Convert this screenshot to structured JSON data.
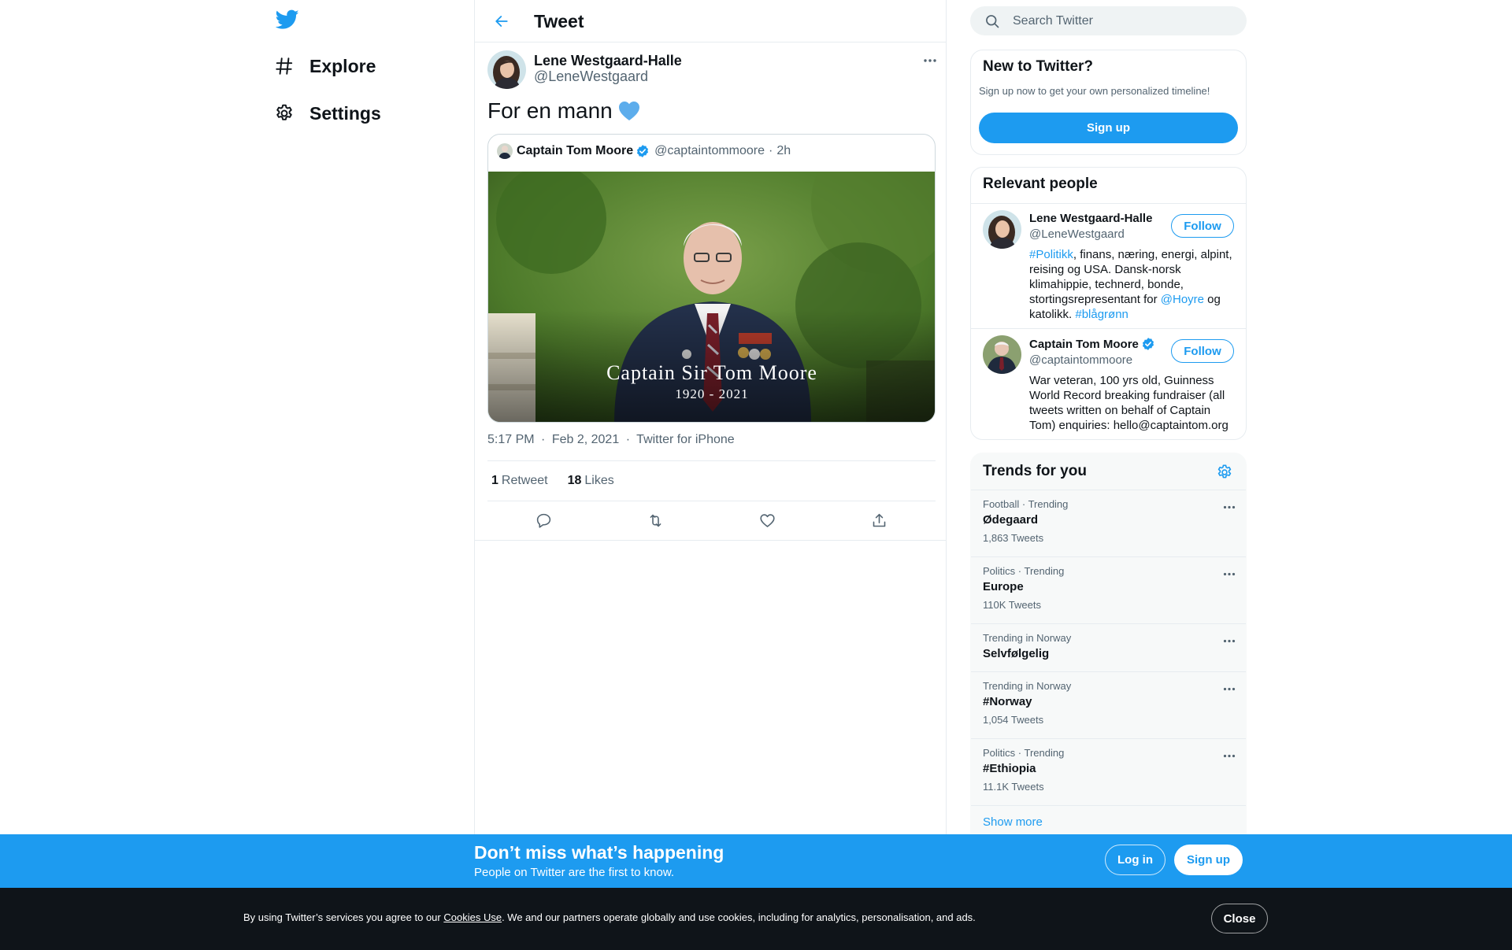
{
  "nav": {
    "items": [
      {
        "label": "Explore",
        "icon": "hashtag-icon"
      },
      {
        "label": "Settings",
        "icon": "gear-icon"
      }
    ]
  },
  "header": {
    "title": "Tweet"
  },
  "tweet": {
    "author_name": "Lene Westgaard-Halle",
    "author_handle": "@LeneWestgaard",
    "text": "For en mann",
    "emoji": "blue-heart",
    "quote": {
      "author_name": "Captain Tom Moore",
      "author_handle": "@captaintommoore",
      "separator": "·",
      "time": "2h",
      "image_title": "Captain Sir Tom Moore",
      "image_years": "1920 - 2021"
    },
    "time": "5:17 PM",
    "dot": "·",
    "date": "Feb 2, 2021",
    "source": "Twitter for iPhone",
    "retweets": "1",
    "retweets_label": "Retweet",
    "likes": "18",
    "likes_label": "Likes"
  },
  "search": {
    "placeholder": "Search Twitter"
  },
  "new_to_twitter": {
    "title": "New to Twitter?",
    "subtitle": "Sign up now to get your own personalized timeline!",
    "button": "Sign up"
  },
  "relevant_people": {
    "title": "Relevant people",
    "follow_label": "Follow",
    "people": [
      {
        "name": "Lene Westgaard-Halle",
        "handle": "@LeneWestgaard",
        "bio_parts": {
          "tag1": "#Politikk",
          "text1": ", finans, næring, energi, alpint, reising og USA. Dansk-norsk klimahippie, technerd, bonde, stortingsrepresentant for ",
          "mention": "@Hoyre",
          "text2": " og katolikk. ",
          "tag2": "#blågrønn"
        }
      },
      {
        "name": "Captain Tom Moore",
        "handle": "@captaintommoore",
        "bio": "War veteran, 100 yrs old, Guinness World Record breaking fundraiser (all tweets written on behalf of Captain Tom) enquiries: hello@captaintom.org"
      }
    ]
  },
  "trends": {
    "title": "Trends for you",
    "items": [
      {
        "context": "Football · Trending",
        "name": "Ødegaard",
        "count": "1,863 Tweets"
      },
      {
        "context": "Politics · Trending",
        "name": "Europe",
        "count": "110K Tweets"
      },
      {
        "context": "Trending in Norway",
        "name": "Selvfølgelig",
        "count": ""
      },
      {
        "context": "Trending in Norway",
        "name": "#Norway",
        "count": "1,054 Tweets"
      },
      {
        "context": "Politics · Trending",
        "name": "#Ethiopia",
        "count": "11.1K Tweets"
      }
    ],
    "show_more": "Show more"
  },
  "signup_bar": {
    "title": "Don’t miss what’s happening",
    "subtitle": "People on Twitter are the first to know.",
    "login": "Log in",
    "signup": "Sign up"
  },
  "cookie_bar": {
    "text_before": "By using Twitter’s services you agree to our ",
    "link": "Cookies Use",
    "text_after": ". We and our partners operate globally and use cookies, including for analytics, personalisation, and ads.",
    "close": "Close"
  },
  "colors": {
    "accent": "#1d9bf0",
    "text": "#0f1419",
    "muted": "#536471",
    "border": "#e7ecf0",
    "cookie_bg": "#0f1419"
  }
}
